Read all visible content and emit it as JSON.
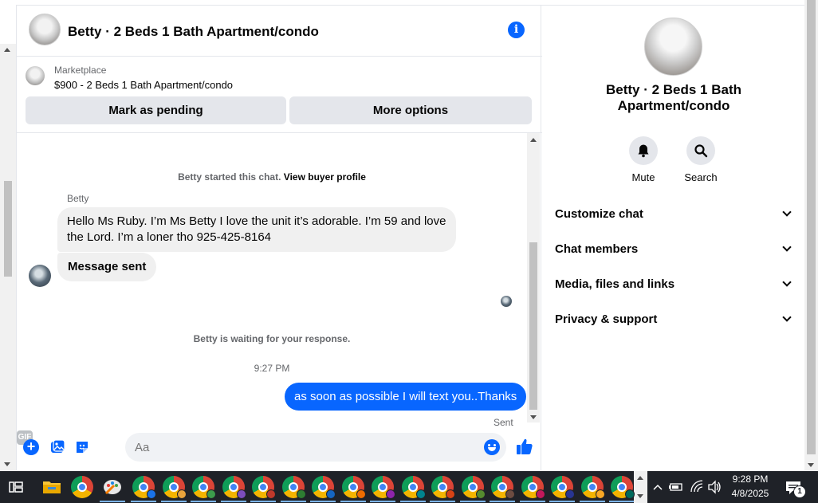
{
  "chat": {
    "title": "Betty · 2 Beds 1 Bath Apartment/condo",
    "marketplace_label": "Marketplace",
    "listing": "$900 - 2 Beds 1 Bath Apartment/condo",
    "mark_pending_label": "Mark as pending",
    "more_options_label": "More options"
  },
  "messages": {
    "started_text": "Betty started this chat.",
    "view_buyer_profile": "View buyer profile",
    "sender_name": "Betty",
    "incoming_1": "Hello Ms Ruby. I’m Ms Betty I love the unit it’s adorable. I’m 59 and love the Lord. I’m a loner tho 925-425-8164",
    "incoming_2": "Message sent",
    "waiting_text": "Betty is waiting for your response.",
    "timestamp": "9:27 PM",
    "outgoing_1": "as soon as possible I will text you..Thanks",
    "status": "Sent"
  },
  "composer": {
    "placeholder": "Aa",
    "gif_label": "GIF"
  },
  "info_panel": {
    "title": "Betty · 2 Beds 1 Bath Apartment/condo",
    "mute_label": "Mute",
    "search_label": "Search",
    "rows": [
      "Customize chat",
      "Chat members",
      "Media, files and links",
      "Privacy & support"
    ]
  },
  "taskbar": {
    "time": "9:28 PM",
    "date": "4/8/2025",
    "notification_count": "1",
    "chrome_badge_colors": [
      "#1a73e8",
      "#e8a33c",
      "#3c9b4b",
      "#7c4dbd",
      "#c0392b",
      "#2e7d32",
      "#1565c0",
      "#ef6c00",
      "#8e24aa",
      "#00838f",
      "#d84315",
      "#558b2f",
      "#6d4c41",
      "#c2185b",
      "#283593",
      "#f9a825",
      "#00695c"
    ]
  }
}
